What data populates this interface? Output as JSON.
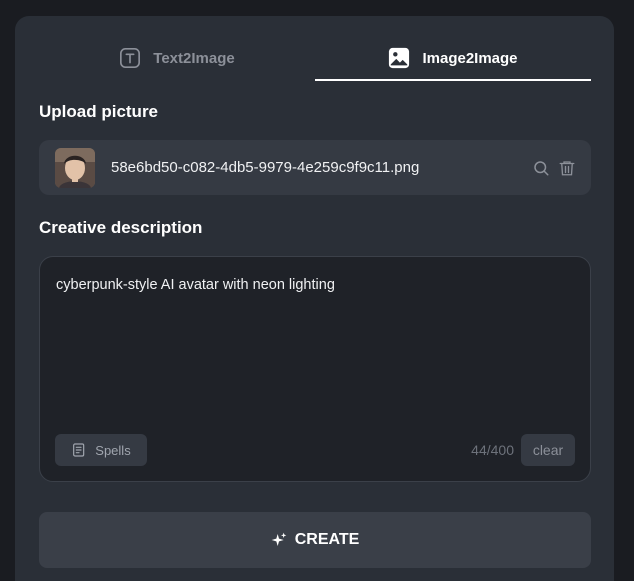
{
  "tabs": [
    {
      "label": "Text2Image",
      "icon": "text-box-icon",
      "active": false
    },
    {
      "label": "Image2Image",
      "icon": "image-icon",
      "active": true
    }
  ],
  "upload": {
    "title": "Upload picture",
    "file_name": "58e6bd50-c082-4db5-9979-4e259c9f9c11.png"
  },
  "description": {
    "title": "Creative description",
    "text": "cyberpunk-style AI avatar with neon lighting",
    "counter": "44/400",
    "spells_label": "Spells",
    "clear_label": "clear"
  },
  "create": {
    "label": "CREATE",
    "icon": "sparkle-icon"
  },
  "colors": {
    "background": "#1a1c21",
    "panel": "#2a2f37",
    "active_tab": "#ffffff",
    "inactive_tab": "#8c9099"
  }
}
